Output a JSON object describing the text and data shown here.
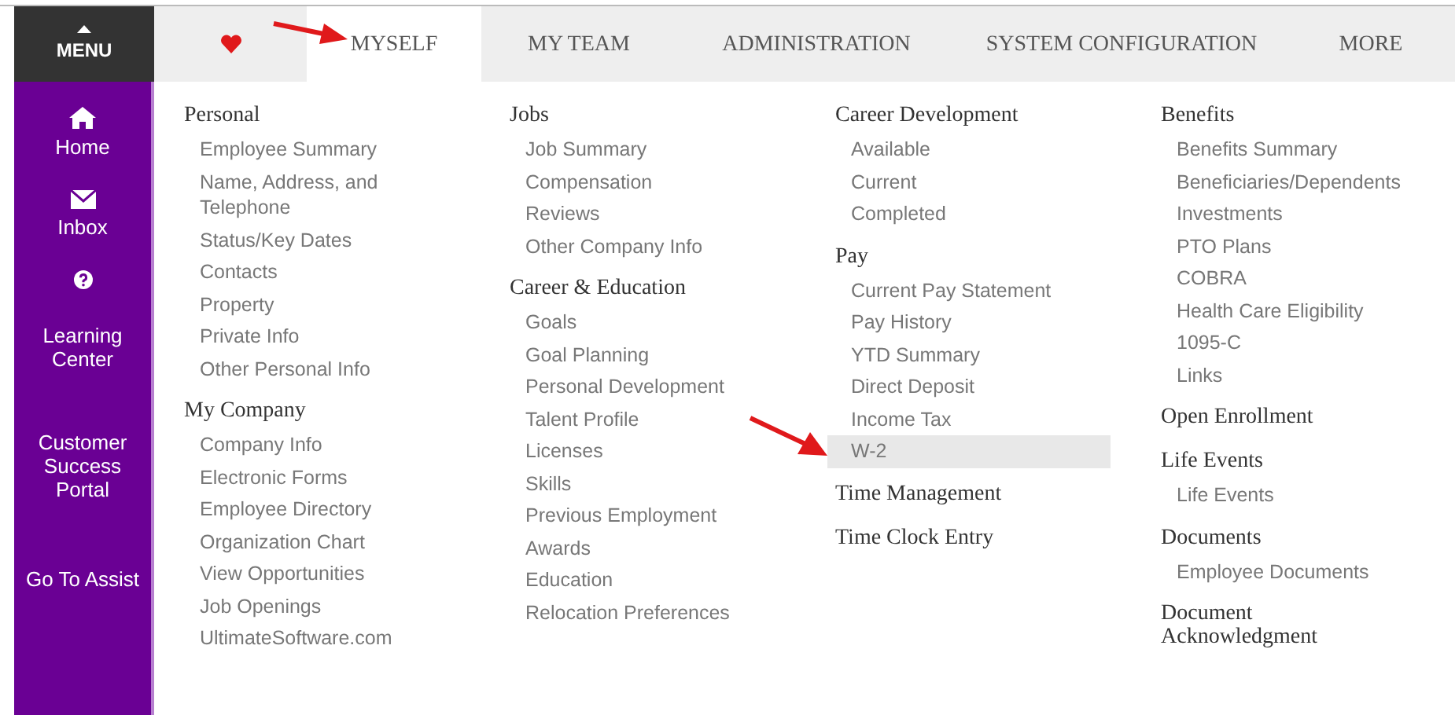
{
  "menu_button": {
    "label": "MENU"
  },
  "tabs": [
    {
      "kind": "icon",
      "selected": false
    },
    {
      "kind": "text",
      "label": "MYSELF",
      "selected": true
    },
    {
      "kind": "text",
      "label": "MY TEAM",
      "selected": false
    },
    {
      "kind": "text",
      "label": "ADMINISTRATION",
      "selected": false
    },
    {
      "kind": "text",
      "label": "SYSTEM CONFIGURATION",
      "selected": false
    },
    {
      "kind": "text",
      "label": "MORE",
      "selected": false
    }
  ],
  "sidebar": {
    "items": [
      {
        "kind": "icon",
        "label": "Home"
      },
      {
        "kind": "icon",
        "label": "Inbox"
      },
      {
        "kind": "icon",
        "label": "Learning Center"
      },
      {
        "kind": "text",
        "label": "Customer Success Portal"
      },
      {
        "kind": "text",
        "label": "Go To Assist"
      }
    ]
  },
  "columns": [
    {
      "sections": [
        {
          "heading": "Personal",
          "items": [
            {
              "label": "Employee Summary",
              "selected": false
            },
            {
              "label": "Name, Address, and Telephone",
              "selected": false
            },
            {
              "label": "Status/Key Dates",
              "selected": false
            },
            {
              "label": "Contacts",
              "selected": false
            },
            {
              "label": "Property",
              "selected": false
            },
            {
              "label": "Private Info",
              "selected": false
            },
            {
              "label": "Other Personal Info",
              "selected": false
            }
          ]
        },
        {
          "heading": "My Company",
          "items": [
            {
              "label": "Company Info",
              "selected": false
            },
            {
              "label": "Electronic Forms",
              "selected": false
            },
            {
              "label": "Employee Directory",
              "selected": false
            },
            {
              "label": "Organization Chart",
              "selected": false
            },
            {
              "label": "View Opportunities",
              "selected": false
            },
            {
              "label": "Job Openings",
              "selected": false
            },
            {
              "label": "UltimateSoftware.com",
              "selected": false
            }
          ]
        }
      ]
    },
    {
      "sections": [
        {
          "heading": "Jobs",
          "items": [
            {
              "label": "Job Summary",
              "selected": false
            },
            {
              "label": "Compensation",
              "selected": false
            },
            {
              "label": "Reviews",
              "selected": false
            },
            {
              "label": "Other Company Info",
              "selected": false
            }
          ]
        },
        {
          "heading": "Career & Education",
          "items": [
            {
              "label": "Goals",
              "selected": false
            },
            {
              "label": "Goal Planning",
              "selected": false
            },
            {
              "label": "Personal Development",
              "selected": false
            },
            {
              "label": "Talent Profile",
              "selected": false
            },
            {
              "label": "Licenses",
              "selected": false
            },
            {
              "label": "Skills",
              "selected": false
            },
            {
              "label": "Previous Employment",
              "selected": false
            },
            {
              "label": "Awards",
              "selected": false
            },
            {
              "label": "Education",
              "selected": false
            },
            {
              "label": "Relocation Preferences",
              "selected": false
            }
          ]
        }
      ]
    },
    {
      "sections": [
        {
          "heading": "Career Development",
          "items": [
            {
              "label": "Available",
              "selected": false
            },
            {
              "label": "Current",
              "selected": false
            },
            {
              "label": "Completed",
              "selected": false
            }
          ]
        },
        {
          "heading": "Pay",
          "items": [
            {
              "label": "Current Pay Statement",
              "selected": false
            },
            {
              "label": "Pay History",
              "selected": false
            },
            {
              "label": "YTD Summary",
              "selected": false
            },
            {
              "label": "Direct Deposit",
              "selected": false
            },
            {
              "label": "Income Tax",
              "selected": false
            },
            {
              "label": "W-2",
              "selected": true
            }
          ]
        },
        {
          "heading": "Time Management"
        },
        {
          "heading": "Time Clock Entry"
        }
      ]
    },
    {
      "sections": [
        {
          "heading": "Benefits",
          "items": [
            {
              "label": "Benefits Summary",
              "selected": false
            },
            {
              "label": "Beneficiaries/Dependents",
              "selected": false
            },
            {
              "label": "Investments",
              "selected": false
            },
            {
              "label": "PTO Plans",
              "selected": false
            },
            {
              "label": "COBRA",
              "selected": false
            },
            {
              "label": "Health Care Eligibility",
              "selected": false
            },
            {
              "label": "1095-C",
              "selected": false
            },
            {
              "label": "Links",
              "selected": false
            }
          ]
        },
        {
          "heading": "Open Enrollment"
        },
        {
          "heading": "Life Events",
          "items": [
            {
              "label": "Life Events",
              "selected": false
            }
          ]
        },
        {
          "heading": "Documents",
          "items": [
            {
              "label": "Employee Documents",
              "selected": false
            }
          ]
        },
        {
          "heading": "Document Acknowledgment"
        }
      ]
    }
  ]
}
